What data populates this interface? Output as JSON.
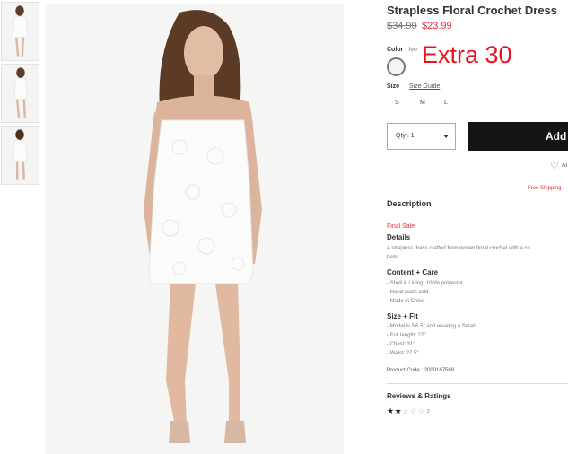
{
  "product": {
    "title": "Strapless Floral Crochet Dress",
    "price_original": "$34.90",
    "price_sale": "$23.99",
    "promo_overlay": "Extra 30"
  },
  "options": {
    "color_label": "Color :",
    "color_value": "Ivo",
    "swatch_color": "#f4f4f2",
    "size_label": "Size",
    "size_guide": "Size Guide",
    "sizes": [
      "S",
      "M",
      "L"
    ]
  },
  "cart": {
    "qty_label": "Qty : 1",
    "add_label": "Add",
    "wishlist_text": "Ad",
    "free_shipping": "Free Shipping"
  },
  "description": {
    "heading": "Description",
    "final_sale": "Final Sale",
    "details_heading": "Details",
    "details_text_line1": "A strapless dress crafted from woven floral crochet with a co",
    "details_text_line2": "hem.",
    "content_heading": "Content + Care",
    "content_items": [
      "- Shell & Lining: 100% polyester",
      "- Hand wash cold",
      "- Made in China"
    ],
    "fit_heading": "Size + Fit",
    "fit_items": [
      "- Model is 5'6.5\" and wearing a Small",
      "- Full length: 27\"",
      "- Chest: 31\"",
      "- Waist: 27.5\""
    ],
    "product_code": "Product Code : 2000167588"
  },
  "reviews": {
    "heading": "Reviews & Ratings",
    "rating": 2,
    "max": 5,
    "count": "2"
  },
  "colors": {
    "sale_red": "#e0303a",
    "promo_red": "#e8141d",
    "button_black": "#141414"
  }
}
